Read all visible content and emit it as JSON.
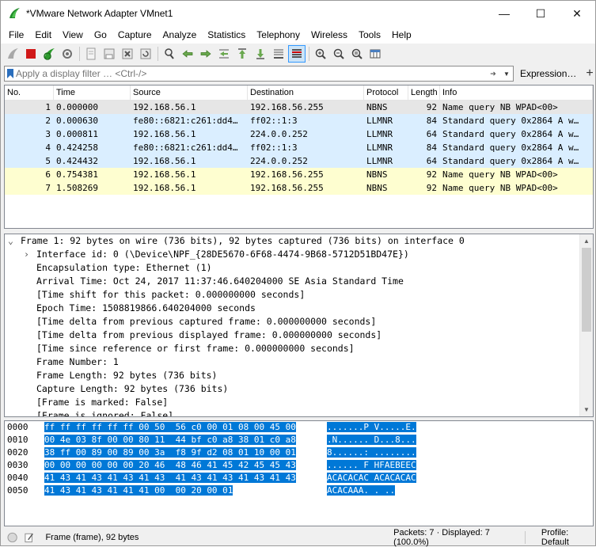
{
  "window": {
    "title": "*VMware Network Adapter VMnet1",
    "controls": {
      "minimize": "—",
      "maximize": "☐",
      "close": "✕"
    }
  },
  "menu": [
    "File",
    "Edit",
    "View",
    "Go",
    "Capture",
    "Analyze",
    "Statistics",
    "Telephony",
    "Wireless",
    "Tools",
    "Help"
  ],
  "toolbar": {
    "icons": [
      "start-capture-icon",
      "stop-capture-icon",
      "restart-capture-icon",
      "capture-options-icon",
      "open-file-icon",
      "save-file-icon",
      "close-file-icon",
      "reload-file-icon",
      "find-packet-icon",
      "go-back-icon",
      "go-forward-icon",
      "go-to-packet-icon",
      "go-first-icon",
      "go-last-icon",
      "autoscroll-icon",
      "colorize-icon",
      "zoom-in-icon",
      "zoom-out-icon",
      "normal-size-icon",
      "resize-columns-icon"
    ]
  },
  "filter": {
    "placeholder": "Apply a display filter … <Ctrl-/>",
    "value": "",
    "expression_label": "Expression…",
    "add_label": "+"
  },
  "packet_list": {
    "columns": [
      "No.",
      "Time",
      "Source",
      "Destination",
      "Protocol",
      "Length",
      "Info"
    ],
    "rows": [
      {
        "no": "1",
        "time": "0.000000",
        "source": "192.168.56.1",
        "destination": "192.168.56.255",
        "protocol": "NBNS",
        "length": "92",
        "info": "Name query NB WPAD<00>",
        "kind": "selected"
      },
      {
        "no": "2",
        "time": "0.000630",
        "source": "fe80::6821:c261:dd4…",
        "destination": "ff02::1:3",
        "protocol": "LLMNR",
        "length": "84",
        "info": "Standard query 0x2864 A w…",
        "kind": "llmnr"
      },
      {
        "no": "3",
        "time": "0.000811",
        "source": "192.168.56.1",
        "destination": "224.0.0.252",
        "protocol": "LLMNR",
        "length": "64",
        "info": "Standard query 0x2864 A w…",
        "kind": "llmnr"
      },
      {
        "no": "4",
        "time": "0.424258",
        "source": "fe80::6821:c261:dd4…",
        "destination": "ff02::1:3",
        "protocol": "LLMNR",
        "length": "84",
        "info": "Standard query 0x2864 A w…",
        "kind": "llmnr"
      },
      {
        "no": "5",
        "time": "0.424432",
        "source": "192.168.56.1",
        "destination": "224.0.0.252",
        "protocol": "LLMNR",
        "length": "64",
        "info": "Standard query 0x2864 A w…",
        "kind": "llmnr"
      },
      {
        "no": "6",
        "time": "0.754381",
        "source": "192.168.56.1",
        "destination": "192.168.56.255",
        "protocol": "NBNS",
        "length": "92",
        "info": "Name query NB WPAD<00>",
        "kind": "nbns"
      },
      {
        "no": "7",
        "time": "1.508269",
        "source": "192.168.56.1",
        "destination": "192.168.56.255",
        "protocol": "NBNS",
        "length": "92",
        "info": "Name query NB WPAD<00>",
        "kind": "nbns"
      }
    ]
  },
  "details": {
    "lines": [
      {
        "text": "Frame 1: 92 bytes on wire (736 bits), 92 bytes captured (736 bits) on interface 0",
        "indent": 0,
        "expander": "v"
      },
      {
        "text": "Interface id: 0 (\\Device\\NPF_{28DE5670-6F68-4474-9B68-5712D51BD47E})",
        "indent": 1,
        "expander": ">"
      },
      {
        "text": "Encapsulation type: Ethernet (1)",
        "indent": 1,
        "expander": ""
      },
      {
        "text": "Arrival Time: Oct 24, 2017 11:37:46.640204000 SE Asia Standard Time",
        "indent": 1,
        "expander": ""
      },
      {
        "text": "[Time shift for this packet: 0.000000000 seconds]",
        "indent": 1,
        "expander": ""
      },
      {
        "text": "Epoch Time: 1508819866.640204000 seconds",
        "indent": 1,
        "expander": ""
      },
      {
        "text": "[Time delta from previous captured frame: 0.000000000 seconds]",
        "indent": 1,
        "expander": ""
      },
      {
        "text": "[Time delta from previous displayed frame: 0.000000000 seconds]",
        "indent": 1,
        "expander": ""
      },
      {
        "text": "[Time since reference or first frame: 0.000000000 seconds]",
        "indent": 1,
        "expander": ""
      },
      {
        "text": "Frame Number: 1",
        "indent": 1,
        "expander": ""
      },
      {
        "text": "Frame Length: 92 bytes (736 bits)",
        "indent": 1,
        "expander": ""
      },
      {
        "text": "Capture Length: 92 bytes (736 bits)",
        "indent": 1,
        "expander": ""
      },
      {
        "text": "[Frame is marked: False]",
        "indent": 1,
        "expander": ""
      },
      {
        "text": "[Frame is ignored: False]",
        "indent": 1,
        "expander": ""
      }
    ]
  },
  "bytes": {
    "lines": [
      {
        "offset": "0000",
        "hex1": "ff ff ff ff ff ff 00 50",
        "hex2": "56 c0 00 01 08 00 45 00",
        "ascii1": ".......P",
        "ascii2": "V.....E."
      },
      {
        "offset": "0010",
        "hex1": "00 4e 03 8f 00 00 80 11",
        "hex2": "44 bf c0 a8 38 01 c0 a8",
        "ascii1": ".N......",
        "ascii2": "D...8..."
      },
      {
        "offset": "0020",
        "hex1": "38 ff 00 89 00 89 00 3a",
        "hex2": "f8 9f d2 08 01 10 00 01",
        "ascii1": "8......:",
        "ascii2": "........"
      },
      {
        "offset": "0030",
        "hex1": "00 00 00 00 00 00 20 46",
        "hex2": "48 46 41 45 42 45 45 43",
        "ascii1": "...... F",
        "ascii2": "HFAEBEEC"
      },
      {
        "offset": "0040",
        "hex1": "41 43 41 43 41 43 41 43",
        "hex2": "41 43 41 43 41 43 41 43",
        "ascii1": "ACACACAC",
        "ascii2": "ACACACAC"
      },
      {
        "offset": "0050",
        "hex1": "41 43 41 43 41 41 41 00",
        "hex2": "00 20 00 01",
        "ascii1": "ACACAAA.",
        "ascii2": ". .."
      }
    ]
  },
  "status": {
    "frame_text": "Frame (frame), 92 bytes",
    "packets_text": "Packets: 7 · Displayed: 7 (100.0%)",
    "profile_text": "Profile: Default"
  },
  "colors": {
    "nbns_row": "#fefed0",
    "llmnr_row": "#daeeff",
    "selection": "#0078d7"
  }
}
